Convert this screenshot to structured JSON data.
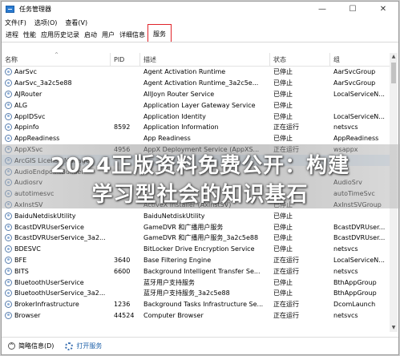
{
  "window": {
    "title": "任务管理器",
    "min": "—",
    "max": "☐",
    "close": "✕"
  },
  "menu": [
    "文件(F)",
    "选项(O)",
    "查看(V)"
  ],
  "tabs": [
    "进程",
    "性能",
    "应用历史记录",
    "启动",
    "用户",
    "详细信息",
    "服务"
  ],
  "columns": {
    "name": "名称",
    "pid": "PID",
    "desc": "描述",
    "status": "状态",
    "group": "组"
  },
  "rows": [
    {
      "name": "AarSvc",
      "pid": "",
      "desc": "Agent Activation Runtime",
      "status": "已停止",
      "group": "AarSvcGroup"
    },
    {
      "name": "AarSvc_3a2c5e88",
      "pid": "",
      "desc": "Agent Activation Runtime_3a2c5e...",
      "status": "已停止",
      "group": "AarSvcGroup"
    },
    {
      "name": "AJRouter",
      "pid": "",
      "desc": "AllJoyn Router Service",
      "status": "已停止",
      "group": "LocalServiceN..."
    },
    {
      "name": "ALG",
      "pid": "",
      "desc": "Application Layer Gateway Service",
      "status": "已停止",
      "group": ""
    },
    {
      "name": "AppIDSvc",
      "pid": "",
      "desc": "Application Identity",
      "status": "已停止",
      "group": "LocalServiceN..."
    },
    {
      "name": "Appinfo",
      "pid": "8592",
      "desc": "Application Information",
      "status": "正在运行",
      "group": "netsvcs"
    },
    {
      "name": "AppReadiness",
      "pid": "",
      "desc": "App Readiness",
      "status": "已停止",
      "group": "AppReadiness"
    },
    {
      "name": "AppXSvc",
      "pid": "4956",
      "desc": "AppX Deployment Service (AppXS...",
      "status": "正在运行",
      "group": "wsappx"
    },
    {
      "name": "ArcGIS License Manager",
      "pid": "",
      "desc": "",
      "status": "",
      "group": ""
    },
    {
      "name": "AudioEndpointBuilder",
      "pid": "",
      "desc": "",
      "status": "",
      "group": ""
    },
    {
      "name": "Audiosrv",
      "pid": "",
      "desc": "",
      "status": "",
      "group": "AudioSrv"
    },
    {
      "name": "autotimesvc",
      "pid": "",
      "desc": "",
      "status": "",
      "group": "autoTimeSvc"
    },
    {
      "name": "AxInstSV",
      "pid": "",
      "desc": "ActiveX Installer (AxInstSV)",
      "status": "已停止",
      "group": "AxInstSVGroup"
    },
    {
      "name": "BaiduNetdiskUtility",
      "pid": "",
      "desc": "BaiduNetdiskUtility",
      "status": "已停止",
      "group": ""
    },
    {
      "name": "BcastDVRUserService",
      "pid": "",
      "desc": "GameDVR 和广播用户服务",
      "status": "已停止",
      "group": "BcastDVRUser..."
    },
    {
      "name": "BcastDVRUserService_3a2...",
      "pid": "",
      "desc": "GameDVR 和广播用户服务_3a2c5e88",
      "status": "已停止",
      "group": "BcastDVRUser..."
    },
    {
      "name": "BDESVC",
      "pid": "",
      "desc": "BitLocker Drive Encryption Service",
      "status": "已停止",
      "group": "netsvcs"
    },
    {
      "name": "BFE",
      "pid": "3640",
      "desc": "Base Filtering Engine",
      "status": "正在运行",
      "group": "LocalServiceN..."
    },
    {
      "name": "BITS",
      "pid": "6600",
      "desc": "Background Intelligent Transfer Se...",
      "status": "正在运行",
      "group": "netsvcs"
    },
    {
      "name": "BluetoothUserService",
      "pid": "",
      "desc": "蓝牙用户支持服务",
      "status": "已停止",
      "group": "BthAppGroup"
    },
    {
      "name": "BluetoothUserService_3a2...",
      "pid": "",
      "desc": "蓝牙用户支持服务_3a2c5e88",
      "status": "已停止",
      "group": "BthAppGroup"
    },
    {
      "name": "BrokerInfrastructure",
      "pid": "1236",
      "desc": "Background Tasks Infrastructure Se...",
      "status": "正在运行",
      "group": "DcomLaunch"
    },
    {
      "name": "Browser",
      "pid": "44524",
      "desc": "Computer Browser",
      "status": "正在运行",
      "group": "netsvcs"
    }
  ],
  "status": {
    "brief": "简略信息(D)",
    "open_services": "打开服务"
  },
  "overlay": {
    "line1": "2024正版资料免费公开：构建",
    "line2": "学习型社会的知识基石"
  }
}
